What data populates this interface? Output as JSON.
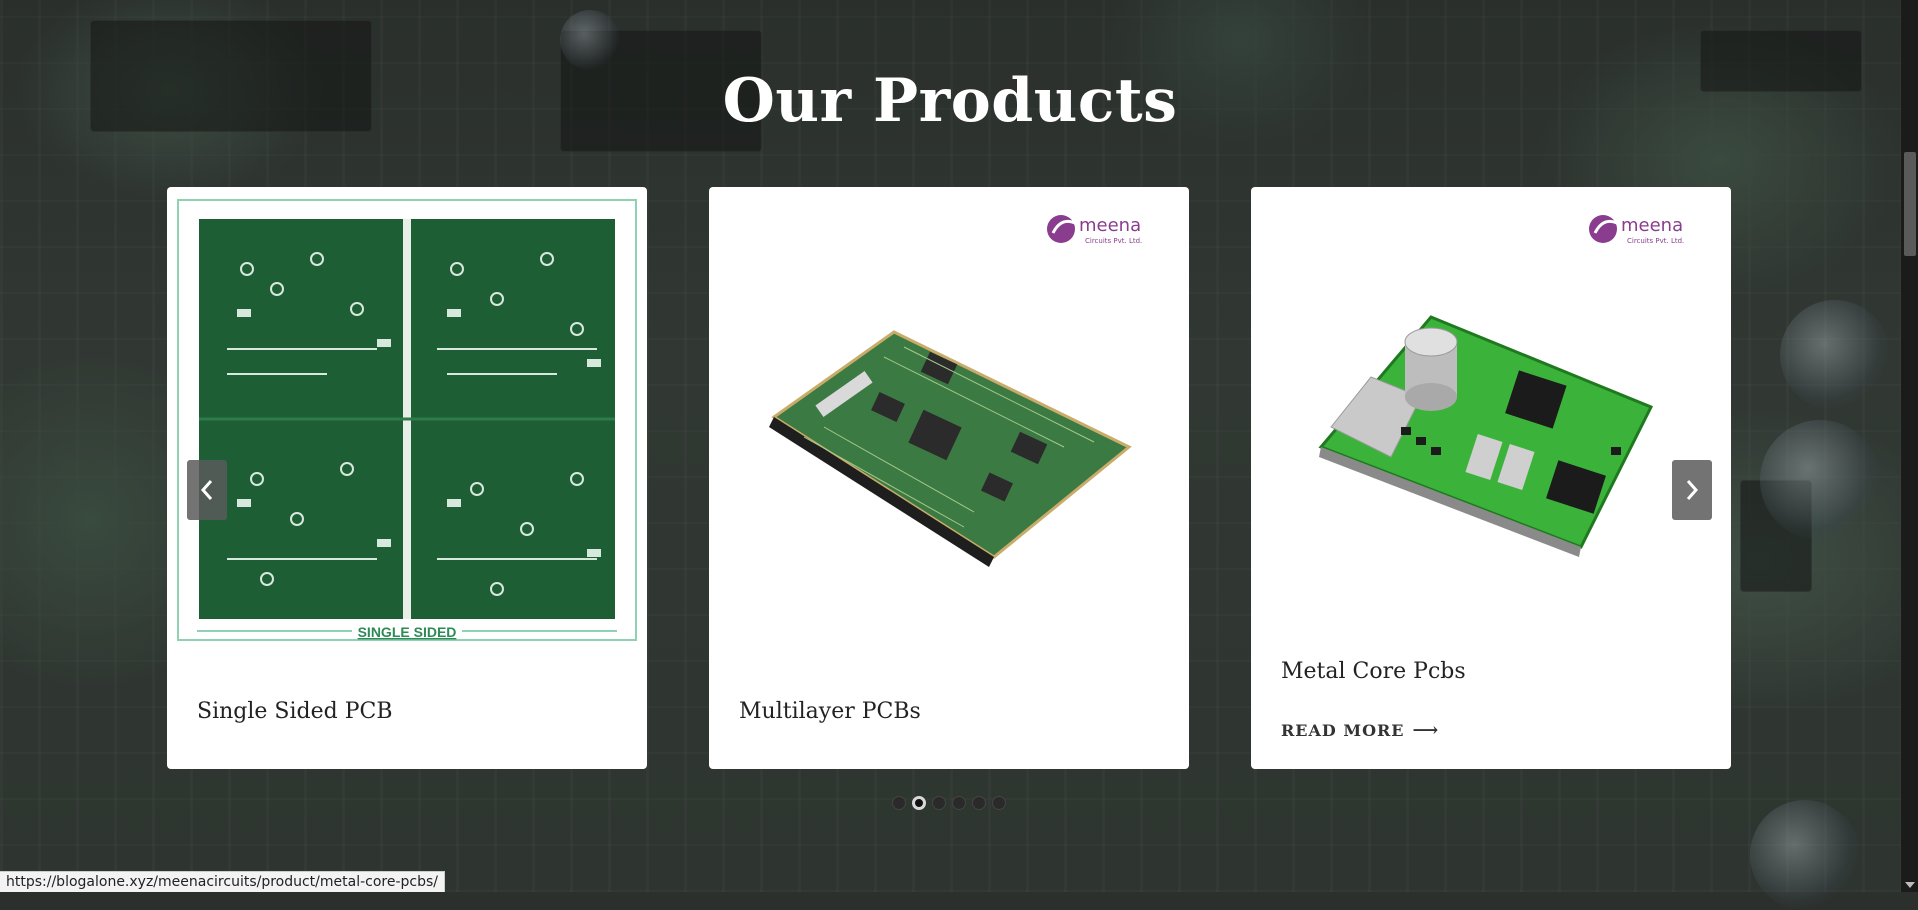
{
  "section": {
    "title": "Our Products"
  },
  "products": [
    {
      "name": "Single Sided PCB",
      "image_caption": "SINGLE SIDED",
      "image_icon": "single-sided-pcb-image"
    },
    {
      "name": "Multilayer PCBs",
      "logo_text": "meena",
      "logo_subtext": "Circuits Pvt. Ltd.",
      "image_icon": "multilayer-pcb-image"
    },
    {
      "name": "Metal Core Pcbs",
      "logo_text": "meena",
      "logo_subtext": "Circuits Pvt. Ltd.",
      "read_more": "READ MORE",
      "read_more_arrow": "⟶",
      "image_icon": "metal-core-pcb-image"
    }
  ],
  "carousel": {
    "prev_icon": "chevron-left-icon",
    "next_icon": "chevron-right-icon",
    "dot_count": 6,
    "active_dot": 2
  },
  "status_bar": {
    "url": "https://blogalone.xyz/meenacircuits/product/metal-core-pcbs/"
  },
  "colors": {
    "card_bg": "#ffffff",
    "title": "#ffffff",
    "logo_purple": "#8a3d8f",
    "pcb_green": "#1f6b3a"
  }
}
